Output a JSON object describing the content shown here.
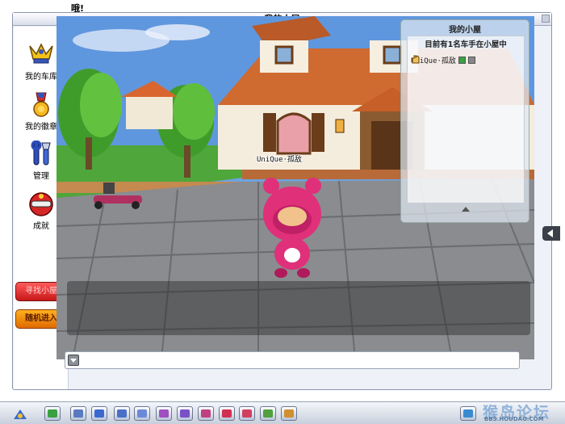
{
  "top_message": "哦!",
  "window": {
    "title": "我的小屋"
  },
  "sidebar": {
    "items": [
      {
        "label": "我的车库",
        "icon": "trophy-garage-icon"
      },
      {
        "label": "我的徽章",
        "icon": "medal-icon"
      },
      {
        "label": "管理",
        "icon": "tools-icon"
      },
      {
        "label": "成就",
        "icon": "achievement-helmet-icon"
      }
    ],
    "find_house_button": "寻找小屋",
    "random_enter_button": "随机进入"
  },
  "scene": {
    "player_nameplate": "UniQue·孤敌"
  },
  "room_panel": {
    "title": "我的小屋",
    "count_text": "目前有1名车手在小屋中",
    "players": [
      {
        "name": "UniQue·孤敌"
      }
    ]
  },
  "chat": {
    "input_value": ""
  },
  "watermark": {
    "main": "猴岛论坛",
    "sub": "BBS.HOUDAO.COM"
  },
  "colors": {
    "window_bg": "#eef1f7",
    "button_red": "#d62020",
    "button_orange": "#f08a10",
    "character_pink": "#e0307a"
  }
}
